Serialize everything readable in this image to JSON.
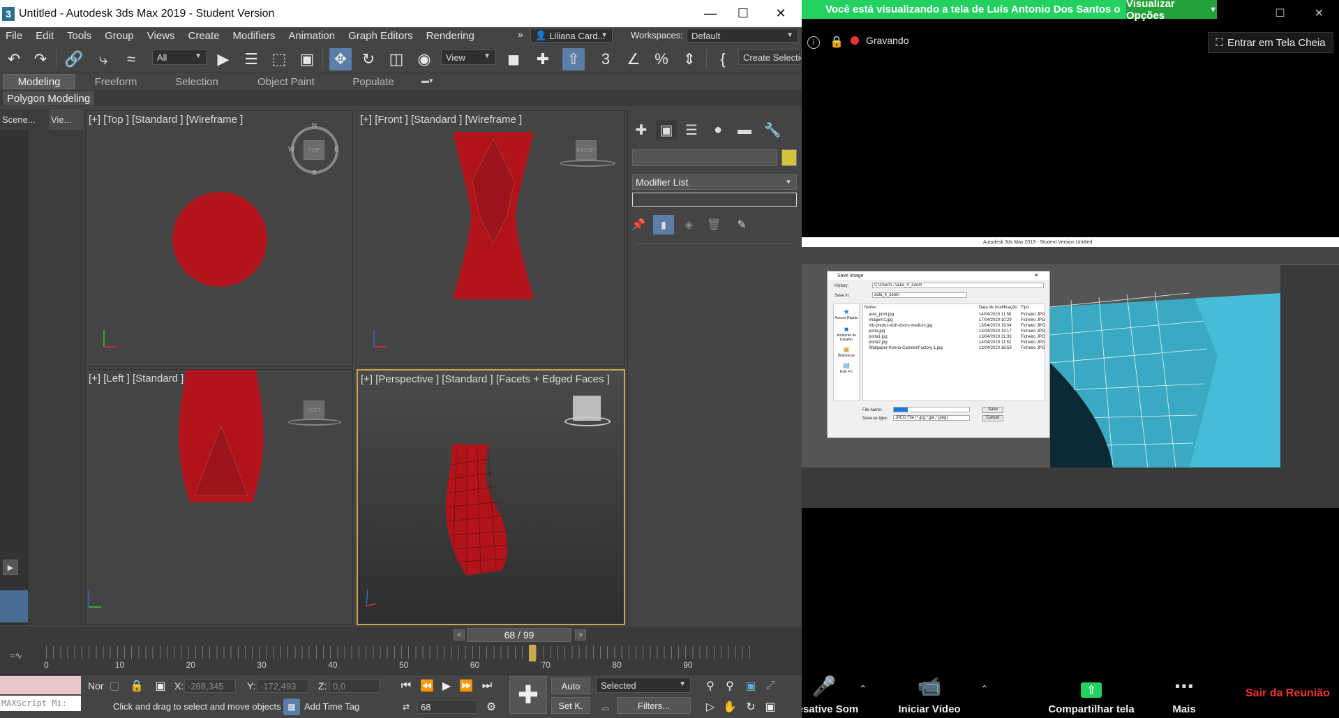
{
  "max": {
    "title": "Untitled - Autodesk 3ds Max 2019 - Student Version",
    "app_icon": "3",
    "menu": [
      "File",
      "Edit",
      "Tools",
      "Group",
      "Views",
      "Create",
      "Modifiers",
      "Animation",
      "Graph Editors",
      "Rendering"
    ],
    "menu_overflow": "»",
    "user": "Liliana Card...",
    "workspaces_label": "Workspaces:",
    "workspaces_value": "Default",
    "toolbar": {
      "filter": "All",
      "ref_coord": "View",
      "create_selection": "Create Selectio"
    },
    "ribbon_tabs": [
      "Modeling",
      "Freeform",
      "Selection",
      "Object Paint",
      "Populate"
    ],
    "ribbon_sub": "Polygon Modeling",
    "scene_tabs": [
      "Scene...",
      "Vie..."
    ],
    "viewports": {
      "top": "[+] [Top ] [Standard ] [Wireframe ]",
      "front": "[+] [Front ] [Standard ] [Wireframe ]",
      "left": "[+] [Left ] [Standard ] [Wireframe ]",
      "perspective": "[+] [Perspective ] [Standard ] [Facets + Edged Faces ]",
      "cube_top": "TOP",
      "cube_front": "FRONT",
      "cube_left": "LEFT",
      "compass": [
        "N",
        "E",
        "S",
        "W"
      ]
    },
    "command_panel": {
      "modifier_list": "Modifier List",
      "color_swatch": "#d4c33a"
    },
    "time": {
      "frame": "68 / 99",
      "ticks": [
        "0",
        "10",
        "20",
        "30",
        "40",
        "50",
        "60",
        "70",
        "80",
        "90"
      ],
      "current": 68,
      "total": 99
    },
    "status": {
      "maxscript": "MAXScript Mi:",
      "mode": "Nor",
      "x_label": "X:",
      "x_value": "-288,345",
      "y_label": "Y:",
      "y_value": "-172,493",
      "z_label": "Z:",
      "z_value": "0,0",
      "prompt": "Click and drag to select and move objects",
      "add_time_tag": "Add Time Tag",
      "auto": "Auto",
      "set_key": "Set K.",
      "selected": "Selected",
      "filters": "Filters...",
      "frame_field": "68"
    },
    "colors": {
      "object_red": "#b0141a",
      "active_viewport": "#c8a84a"
    }
  },
  "zoom": {
    "banner": "Você está visualizando a tela de Luís Antonio Dos Santos o",
    "view_options": "Visualizar Opções",
    "recording": "Gravando",
    "fullscreen": "Entrar em Tela Cheia",
    "bar": {
      "mute": "Desative Som",
      "video": "Iniciar Vídeo",
      "share": "Compartilhar tela",
      "more": "Mais",
      "leave": "Sair da Reunião"
    },
    "shared": {
      "title": "Autodesk 3ds Max 2019 - Student Version   Untitled",
      "dialog_title": "Save Image",
      "history_label": "History:",
      "history_value": "C:\\Users\\...\\aula_4_Zoom",
      "savein_label": "Save in:",
      "savein_value": "aula_4_zoom",
      "col_name": "Nome",
      "col_date": "Data de modificação",
      "col_type": "Tipo",
      "files": [
        {
          "name": "aula_print.jpg",
          "date": "14/04/2020 11:58",
          "type": "Ficheiro JPG"
        },
        {
          "name": "imagem1.jpg",
          "date": "17/04/2020 10:29",
          "type": "Ficheiro JPG"
        },
        {
          "name": "mb-photos-irish-doors-medium.jpg",
          "date": "13/04/2020 19:04",
          "type": "Ficheiro JPG"
        },
        {
          "name": "porta.jpg",
          "date": "13/04/2020 19:17",
          "type": "Ficheiro JPG"
        },
        {
          "name": "porta1.jpg",
          "date": "13/04/2020 21:33",
          "type": "Ficheiro JPG"
        },
        {
          "name": "porta2.jpg",
          "date": "14/04/2020 11:52",
          "type": "Ficheiro JPG"
        },
        {
          "name": "Wallpaper-Kenna-CamdenFactory-1.jpg",
          "date": "13/04/2020 18:59",
          "type": "Ficheiro JPG"
        }
      ],
      "places": [
        "Acesso Rápido",
        "Ambiente de trabalho",
        "Bibliotecas",
        "Este PC"
      ],
      "filename_label": "File name:",
      "filetype_label": "Save as type:",
      "filetype_value": "JPEG File (*.jpg,*.jpe,*.jpeg)",
      "save_btn": "Save",
      "cancel_btn": "Cancel"
    }
  }
}
